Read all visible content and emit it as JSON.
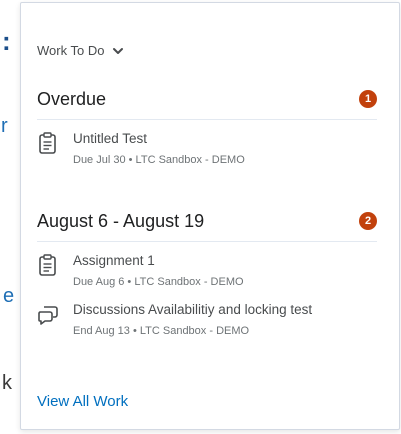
{
  "background": {
    "glyph1": ":",
    "glyph2": "r",
    "glyph3": "e",
    "glyph4": "k"
  },
  "widget": {
    "title": "Work To Do",
    "sections": [
      {
        "title": "Overdue",
        "count": "1",
        "items": [
          {
            "icon": "quiz-icon",
            "title": "Untitled Test",
            "meta": "Due Jul 30 • LTC Sandbox - DEMO"
          }
        ]
      },
      {
        "title": "August 6 - August 19",
        "count": "2",
        "items": [
          {
            "icon": "assignment-icon",
            "title": "Assignment 1",
            "meta": "Due Aug 6 • LTC Sandbox - DEMO"
          },
          {
            "icon": "discussion-icon",
            "title": "Discussions Availabilitiy and locking test",
            "meta": "End Aug 13 • LTC Sandbox - DEMO"
          }
        ]
      }
    ],
    "view_all_label": "View All Work"
  },
  "colors": {
    "badge": "#c2410c",
    "link": "#006fbf",
    "text": "#494c4e"
  }
}
